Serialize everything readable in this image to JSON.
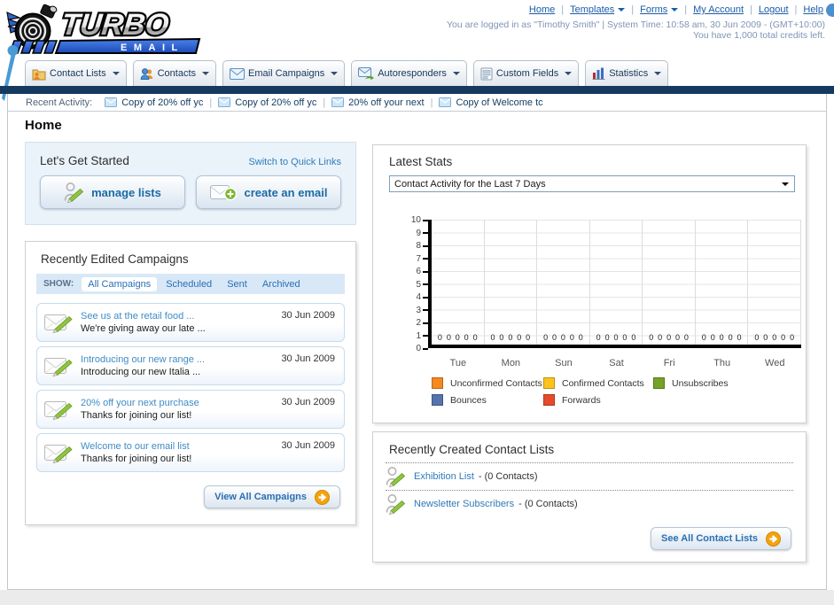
{
  "header": {
    "logo_title": "TURBO",
    "logo_subtitle": "EMAIL",
    "nav_links": [
      {
        "label": "Home",
        "dropdown": false
      },
      {
        "label": "Templates",
        "dropdown": true
      },
      {
        "label": "Forms",
        "dropdown": true
      },
      {
        "label": "My Account",
        "dropdown": false
      },
      {
        "label": "Logout",
        "dropdown": false
      },
      {
        "label": "Help",
        "dropdown": false
      }
    ],
    "login_info": "You are logged in as \"Timothy Smith\" | System Time: 10:58 am, 30 Jun 2009 - (GMT+10:00)",
    "credits_info": "You have 1,000 total credits left."
  },
  "nav_tabs": [
    {
      "label": "Contact Lists",
      "icon": "folder-user-icon"
    },
    {
      "label": "Contacts",
      "icon": "people-icon"
    },
    {
      "label": "Email Campaigns",
      "icon": "envelope-icon"
    },
    {
      "label": "Autoresponders",
      "icon": "envelope-arrow-icon"
    },
    {
      "label": "Custom Fields",
      "icon": "form-fields-icon"
    },
    {
      "label": "Statistics",
      "icon": "bar-chart-icon"
    }
  ],
  "recent_activity": {
    "label": "Recent Activity:",
    "items": [
      "Copy of 20% off yc",
      "Copy of 20% off yc",
      "20% off your next",
      "Copy of Welcome tc"
    ]
  },
  "page_title": "Home",
  "get_started": {
    "title": "Let's Get Started",
    "switch_link": "Switch to Quick Links",
    "buttons": [
      {
        "label": "manage lists",
        "icon": "person-pencil-icon"
      },
      {
        "label": "create an email",
        "icon": "envelope-plus-icon"
      }
    ]
  },
  "campaigns": {
    "title": "Recently Edited Campaigns",
    "show_label": "SHOW:",
    "filters": [
      "All Campaigns",
      "Scheduled",
      "Sent",
      "Archived"
    ],
    "active_filter": "All Campaigns",
    "items": [
      {
        "title": "See us at the retail food ...",
        "subtitle": "We're giving away our late ...",
        "date": "30 Jun 2009"
      },
      {
        "title": "Introducing our new range ...",
        "subtitle": "Introducing our new Italia ...",
        "date": "30 Jun 2009"
      },
      {
        "title": "20% off your next purchase",
        "subtitle": "Thanks for joining our list!",
        "date": "30 Jun 2009"
      },
      {
        "title": "Welcome to our email list",
        "subtitle": "Thanks for joining our list!",
        "date": "30 Jun 2009"
      }
    ],
    "view_all_label": "View All Campaigns"
  },
  "stats": {
    "title": "Latest Stats",
    "dropdown_value": "Contact Activity for the Last 7 Days",
    "chart_data": {
      "type": "bar",
      "categories": [
        "Tue",
        "Mon",
        "Sun",
        "Sat",
        "Fri",
        "Thu",
        "Wed"
      ],
      "series": [
        {
          "name": "Unconfirmed Contacts",
          "color": "#f5881f",
          "values": [
            0,
            0,
            0,
            0,
            0,
            0,
            0
          ]
        },
        {
          "name": "Confirmed Contacts",
          "color": "#fcc31c",
          "values": [
            0,
            0,
            0,
            0,
            0,
            0,
            0
          ]
        },
        {
          "name": "Unsubscribes",
          "color": "#74a326",
          "values": [
            0,
            0,
            0,
            0,
            0,
            0,
            0
          ]
        },
        {
          "name": "Bounces",
          "color": "#5673ae",
          "values": [
            0,
            0,
            0,
            0,
            0,
            0,
            0
          ]
        },
        {
          "name": "Forwards",
          "color": "#e74a2b",
          "values": [
            0,
            0,
            0,
            0,
            0,
            0,
            0
          ]
        }
      ],
      "ylim": [
        0,
        10
      ],
      "yticks": [
        0,
        1,
        2,
        3,
        4,
        5,
        6,
        7,
        8,
        9,
        10
      ],
      "grid": true,
      "legend_position": "bottom"
    }
  },
  "contact_lists": {
    "title": "Recently Created Contact Lists",
    "items": [
      {
        "name": "Exhibition List",
        "detail": "- (0 Contacts)",
        "icon": "person-pencil-icon"
      },
      {
        "name": "Newsletter Subscribers",
        "detail": "- (0 Contacts)",
        "icon": "person-pencil-icon"
      }
    ],
    "see_all_label": "See All Contact Lists"
  }
}
